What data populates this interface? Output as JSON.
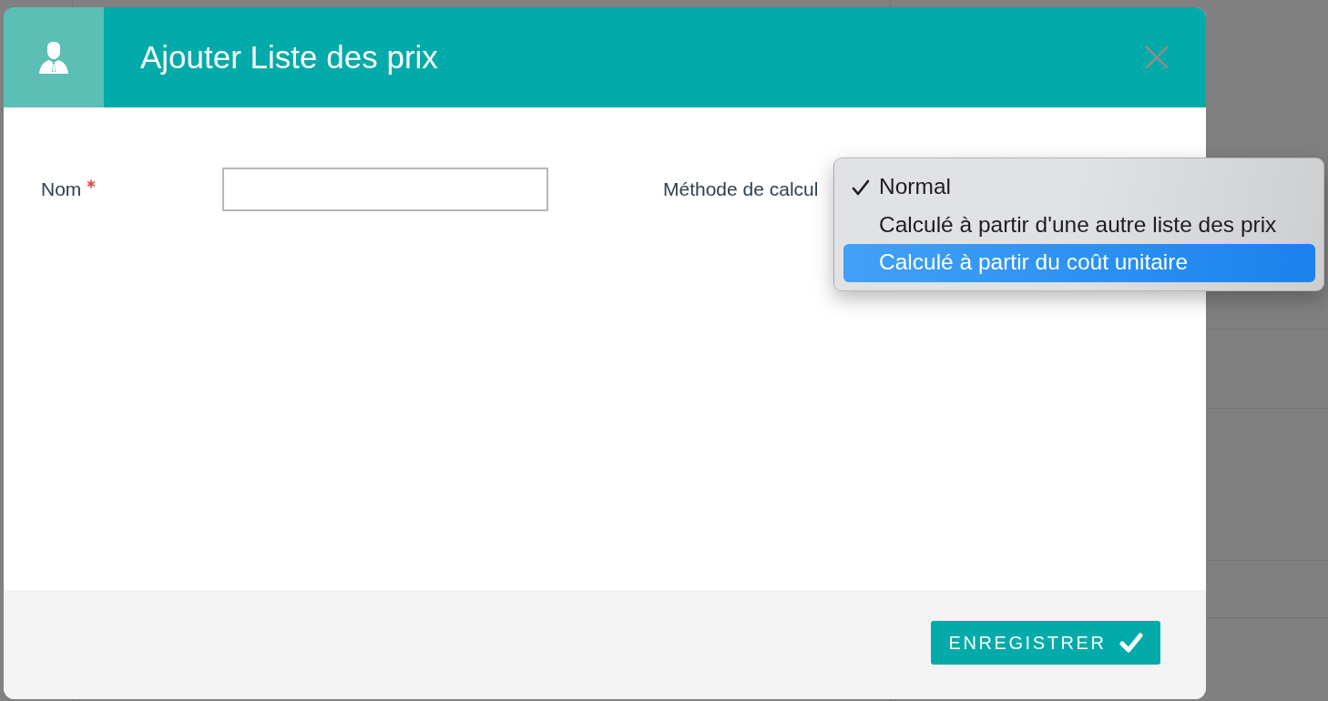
{
  "dialog": {
    "title": "Ajouter Liste des prix",
    "fields": [
      {
        "kind": "text",
        "label": "Nom",
        "required": true
      },
      {
        "kind": "select",
        "label": "Méthode de calcul",
        "required": false,
        "open": true,
        "options": [
          {
            "label": "Normal",
            "selected": true,
            "highlighted": false
          },
          {
            "label": "Calculé à partir d'une autre liste des prix",
            "selected": false,
            "highlighted": false
          },
          {
            "label": "Calculé à partir du coût unitaire",
            "selected": false,
            "highlighted": true
          }
        ]
      }
    ],
    "save_button": {
      "label": "ENREGISTRER"
    }
  }
}
